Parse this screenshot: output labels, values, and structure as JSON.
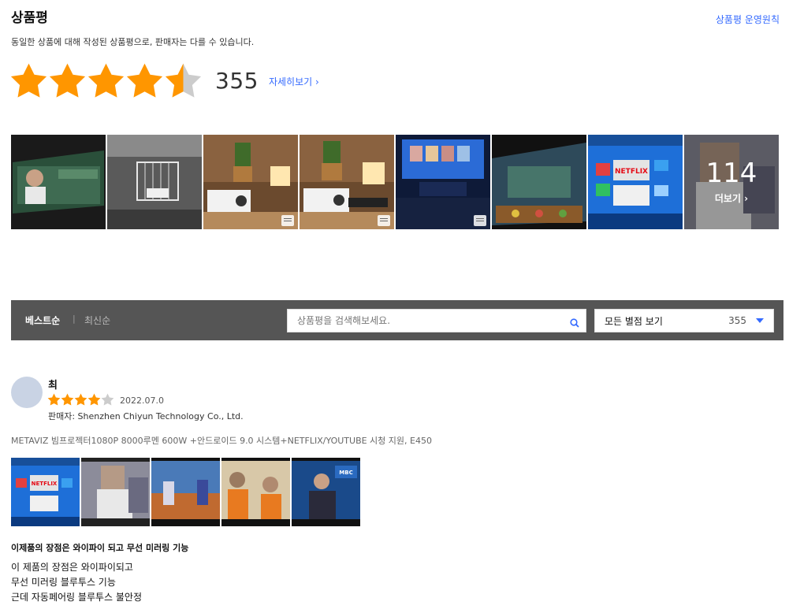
{
  "header": {
    "title": "상품평",
    "policy_link": "상품평 운영원칙",
    "subtitle": "동일한 상품에 대해 작성된 상품평으로, 판매자는 다를 수 있습니다."
  },
  "rating": {
    "stars": 4.5,
    "count": "355",
    "detail_link": "자세히보기"
  },
  "gallery": {
    "more_count": "114",
    "more_label": "더보기"
  },
  "filter": {
    "sort_best": "베스트순",
    "sort_separator": "|",
    "sort_new": "최신순",
    "search_placeholder": "상품평을 검색해보세요.",
    "select_label": "모든 별점 보기",
    "select_count": "355"
  },
  "review": {
    "reviewer_name": "최 ",
    "stars": 4,
    "date": "2022.07.0",
    "seller": "판매자: Shenzhen Chiyun Technology Co., Ltd.",
    "product": "METAVIZ 빔프로젝터1080P 8000루멘 600W +안드로이드 9.0 시스템+NETFLIX/YOUTUBE 시청 지원, E450",
    "headline": "이제품의 장점은 와이파이 되고 무선 미러링 기능",
    "body_lines": [
      "이 제품의 장점은 와이파이되고",
      "무선 미러링 블루투스 기능",
      "근데 자동페어링 블루투스 불안정"
    ]
  },
  "colors": {
    "star": "#ff9600",
    "star_empty": "#ccc",
    "link": "#346aff",
    "filter_bar": "#555555"
  }
}
